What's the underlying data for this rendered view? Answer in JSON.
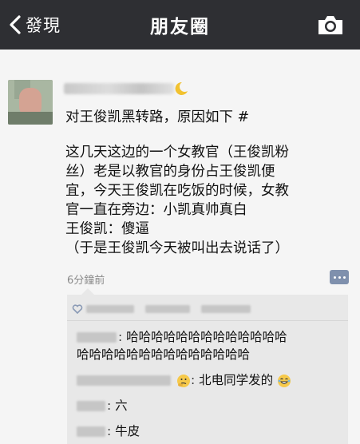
{
  "navbar": {
    "back_label": "發現",
    "title": "朋友圈"
  },
  "post": {
    "lines": [
      "对王俊凯黑转路，原因如下 #",
      "",
      "这几天这边的一个女教官（王俊凯粉",
      "丝）老是以教官的身份占王俊凯便",
      "宜，今天王俊凯在吃饭的时候，女教",
      "官一直在旁边：小凯真帅真白",
      "王俊凯：傻逼",
      "（于是王俊凯今天被叫出去说话了）"
    ],
    "timestamp": "6分鐘前"
  },
  "comments": [
    {
      "line1": "哈哈哈哈哈哈哈哈哈哈哈哈哈",
      "line2": "哈哈哈哈哈哈哈哈哈哈哈哈哈哈"
    },
    {
      "text": "北电同学发的"
    },
    {
      "text": "六"
    },
    {
      "text": "牛皮"
    }
  ],
  "colors": {
    "navbar_bg": "#2e2f33",
    "comment_button": "#7f90ad",
    "comment_box": "#e8e8e8"
  },
  "icons": {
    "back": "chevron-left-icon",
    "camera": "camera-icon",
    "comment": "comment-icon",
    "like": "heart-icon"
  }
}
